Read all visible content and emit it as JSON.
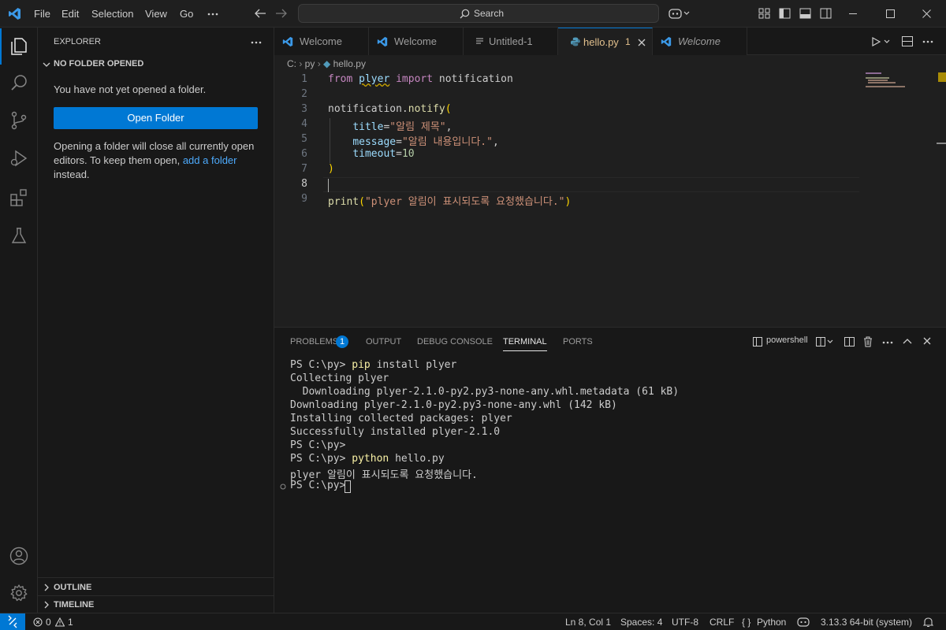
{
  "menu": [
    "File",
    "Edit",
    "Selection",
    "View",
    "Go"
  ],
  "search": {
    "label": "Search"
  },
  "sidebar": {
    "title": "EXPLORER",
    "section": "NO FOLDER OPENED",
    "message": "You have not yet opened a folder.",
    "button": "Open Folder",
    "note_pre": "Opening a folder will close all currently open editors. To keep them open,",
    "note_link": "add a folder",
    "note_post": "instead.",
    "outline": "OUTLINE",
    "timeline": "TIMELINE"
  },
  "tabs": [
    {
      "label": "Welcome"
    },
    {
      "label": "Welcome"
    },
    {
      "label": "Untitled-1"
    },
    {
      "label": "hello.py",
      "badge": "1"
    },
    {
      "label": "Welcome"
    }
  ],
  "breadcrumb": {
    "drive": "C:",
    "folder": "py",
    "file": "hello.py"
  },
  "editor": {
    "line_numbers": [
      "1",
      "2",
      "3",
      "4",
      "5",
      "6",
      "7",
      "8",
      "9"
    ],
    "l1_from": "from",
    "l1_module": "plyer",
    "l1_import": "import",
    "l1_name": "notification",
    "l3_obj": "notification.",
    "l3_fn": "notify",
    "l3_paren": "(",
    "l4_param": "title",
    "l4_eq": "=",
    "l4_str": "\"알림 제목\"",
    "l4_comma": ",",
    "l5_param": "message",
    "l5_eq": "=",
    "l5_str": "\"알림 내용입니다.\"",
    "l5_comma": ",",
    "l6_param": "timeout",
    "l6_eq": "=",
    "l6_num": "10",
    "l7_paren": ")",
    "l9_fn": "print",
    "l9_open": "(",
    "l9_str": "\"plyer 알림이 표시되도록 요청했습니다.\"",
    "l9_close": ")"
  },
  "panel": {
    "tabs": [
      "PROBLEMS",
      "OUTPUT",
      "DEBUG CONSOLE",
      "TERMINAL",
      "PORTS"
    ],
    "problems_badge": "1",
    "shell": "powershell"
  },
  "terminal": {
    "prompt": "PS C:\\py>",
    "l1_cmd": "pip",
    "l1_rest": "install plyer",
    "l2": "Collecting plyer",
    "l3": "  Downloading plyer-2.1.0-py2.py3-none-any.whl.metadata (61 kB)",
    "l4": "Downloading plyer-2.1.0-py2.py3-none-any.whl (142 kB)",
    "l5": "Installing collected packages: plyer",
    "l6": "Successfully installed plyer-2.1.0",
    "l8_cmd": "python",
    "l8_rest": "hello.py",
    "l9": "plyer 알림이 표시되도록 요청했습니다."
  },
  "status": {
    "errors": "0",
    "warnings": "1",
    "position": "Ln 8, Col 1",
    "spaces": "Spaces: 4",
    "encoding": "UTF-8",
    "eol": "CRLF",
    "language": "Python",
    "interpreter": "3.13.3 64-bit (system)"
  },
  "colors": {
    "accent": "#0078d4",
    "background": "#1f1f1f",
    "sidebar": "#181818",
    "modified": "#e2c08d",
    "link": "#4daafc"
  }
}
